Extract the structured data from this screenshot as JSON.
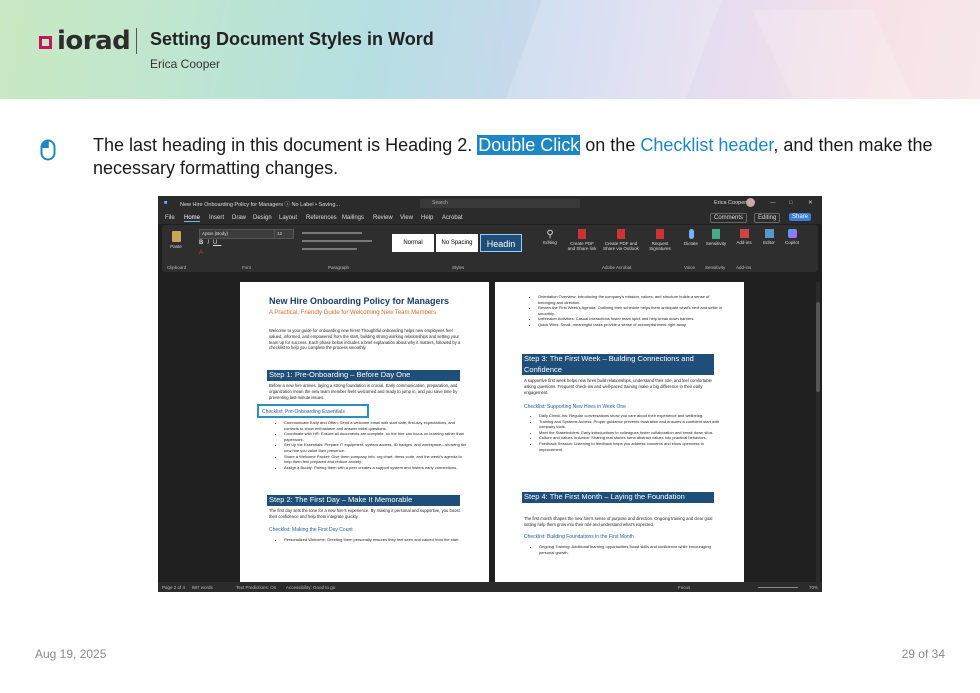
{
  "header": {
    "logo_text": "iorad",
    "title": "Setting Document Styles in Word",
    "author": "Erica Cooper"
  },
  "instruction": {
    "part1": "The last heading in this document is Heading 2. ",
    "highlight": "Double Click",
    "part2": " on the ",
    "link": "Checklist header",
    "part3": ", and then make the necessary formatting changes."
  },
  "word": {
    "titlebar_text": "New Hire Onboarding Policy for Managers  ⓘ No Label • Saving...",
    "search_placeholder": "Search",
    "user_name": "Erica Cooper",
    "menu": [
      "File",
      "Home",
      "Insert",
      "Draw",
      "Design",
      "Layout",
      "References",
      "Mailings",
      "Review",
      "View",
      "Help",
      "Acrobat"
    ],
    "comments_btn": "Comments",
    "editing_btn": "Editing",
    "share_btn": "Share",
    "ribbon": {
      "paste": "Paste",
      "font_name": "Aptos (Body)",
      "font_size": "12",
      "styles": [
        "Normal",
        "No Spacing",
        "Headin"
      ],
      "editing": "Editing",
      "create_pdf_share": "Create PDF and Share link",
      "create_pdf_outlook": "Create PDF and Share via Outlook",
      "request_sigs": "Request Signatures",
      "dictate": "Dictate",
      "sensitivity": "Sensitivity",
      "addins": "Add-ins",
      "editor": "Editor",
      "copilot": "Copilot",
      "groups": [
        "Clipboard",
        "Font",
        "Paragraph",
        "Styles",
        "Adobe Acrobat",
        "Voice",
        "Sensitivity",
        "Add-ins"
      ]
    },
    "doc": {
      "title": "New Hire Onboarding Policy for Managers",
      "subtitle": "A Practical, Friendly Guide for Welcoming New Team Members",
      "intro": "Welcome to your guide for onboarding new hires! Thoughtful onboarding helps new employees feel valued, informed, and empowered from the start, building strong working relationships and setting your team up for success. Each phase below includes a brief explanation about why it matters, followed by a checklist to help you complete the process smoothly.",
      "step1": "Step 1: Pre-Onboarding – Before Day One",
      "step1_text": "Before a new hire arrives, laying a strong foundation is crucial. Early communication, preparation, and organization mean the new team member feels welcomed and ready to jump in, and you save time by preventing last-minute issues.",
      "check1": "Checklist: Pre-Onboarding Essentials",
      "check1_items": [
        "Communicate Early and Often: Send a welcome email with start date, first-day expectations, and contacts to show enthusiasm and answer initial questions.",
        "Coordinate with HR: Ensure all documents are complete, so the hire can focus on learning rather than paperwork.",
        "Set Up the Essentials: Prepare IT equipment, system access, ID badges, and workspace—showing the new hire you value their presence.",
        "Share a Welcome Packet: Give them company info, org chart, dress code, and the week's agenda to help them feel prepared and reduce anxiety.",
        "Assign a Buddy: Pairing them with a peer creates a support system and fosters early connections."
      ],
      "step2": "Step 2: The First Day – Make It Memorable",
      "step2_text": "The first day sets the tone for a new hire's experience. By making it personal and supportive, you boost their confidence and help them integrate quickly.",
      "check2": "Checklist: Making the First Day Count",
      "check2_items": [
        "Personalized Welcome: Greeting them personally ensures they feel seen and valued from the start."
      ],
      "right_items_top": [
        "Orientation Overview: Introducing the company's mission, values, and structure builds a sense of belonging and direction.",
        "Review the First Week's Agenda: Outlining their schedule helps them anticipate what's next and settle in smoothly.",
        "Icebreaker Activities: Casual interactions foster team spirit and help break down barriers.",
        "Quick Wins: Small, meaningful tasks provide a sense of accomplishment right away."
      ],
      "step3": "Step 3: The First Week – Building Connections and Confidence",
      "step3_text": "A supportive first week helps new hires build relationships, understand their role, and feel comfortable asking questions. Frequent check-ins and well-paced training make a big difference in their early engagement.",
      "check3": "Checklist: Supporting New Hires in Week One",
      "check3_items": [
        "Daily Check-Ins: Regular conversations show you care about their experience and wellbeing.",
        "Training and Systems Access: Proper guidance prevents frustration and ensures a confident start with company tools.",
        "Meet the Stakeholders: Early introductions to colleagues foster collaboration and break down silos.",
        "Culture and Values in Action: Sharing real stories turns abstract values into practical behaviors.",
        "Feedback Session: Listening to feedback helps you address concerns and show openness to improvement."
      ],
      "step4": "Step 4: The First Month – Laying the Foundation",
      "step4_text": "The first month shapes the new hire's sense of purpose and direction. Ongoing training and clear goal setting help them grow into their role and understand what's expected.",
      "check4": "Checklist: Building Foundations in the First Month",
      "check4_items": [
        "Ongoing Training: Additional learning opportunities boost skills and confidence while encouraging personal growth."
      ]
    },
    "status": {
      "page": "Page 2 of 4",
      "words": "887 words",
      "predictions": "Text Predictions: On",
      "accessibility": "Accessibility: Good to go",
      "focus": "Focus",
      "zoom": "70%"
    }
  },
  "footer": {
    "date": "Aug 19, 2025",
    "page": "29 of 34"
  }
}
